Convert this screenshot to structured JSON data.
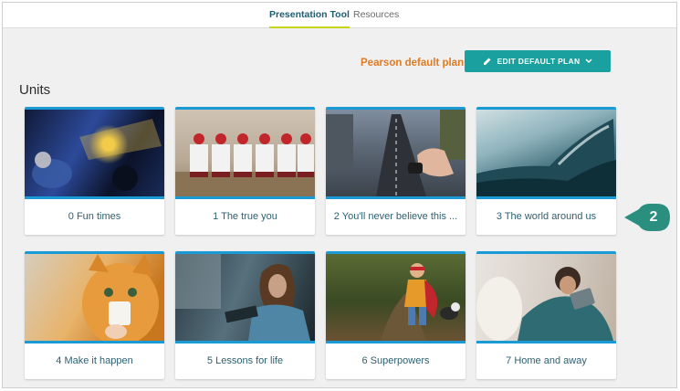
{
  "tabs": [
    {
      "label": "Presentation Tool",
      "active": true
    },
    {
      "label": "Resources",
      "active": false
    }
  ],
  "plan": {
    "label": "Pearson default plan",
    "edit_button": "EDIT DEFAULT PLAN"
  },
  "units_heading": "Units",
  "units": [
    {
      "label": "0 Fun times",
      "icon": "go-kart-photo"
    },
    {
      "label": "1 The true you",
      "icon": "baseball-team-photo"
    },
    {
      "label": "2 You'll never believe this ...",
      "icon": "city-road-photo"
    },
    {
      "label": "3 The world around us",
      "icon": "ocean-wave-photo"
    },
    {
      "label": "4 Make it happen",
      "icon": "cat-photo"
    },
    {
      "label": "5 Lessons for life",
      "icon": "reading-train-photo"
    },
    {
      "label": "6 Superpowers",
      "icon": "superhero-kid-photo"
    },
    {
      "label": "7 Home and away",
      "icon": "boy-tablet-photo"
    }
  ],
  "callout": {
    "number": "2"
  },
  "colors": {
    "accent_teal": "#1ba0a0",
    "plan_orange": "#e07b22",
    "card_border_blue": "#1a9bd6",
    "tab_underline": "#c8d419",
    "callout_teal": "#2a8f7f"
  }
}
